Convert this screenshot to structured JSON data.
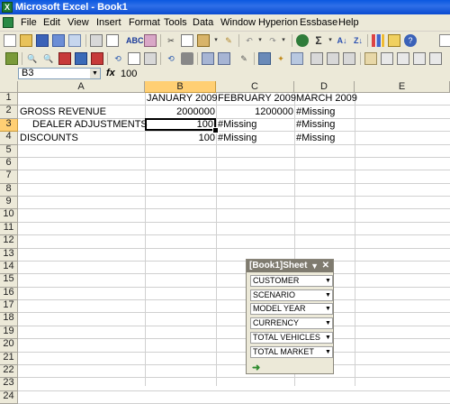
{
  "window": {
    "title": "Microsoft Excel - Book1"
  },
  "menu": [
    "File",
    "Edit",
    "View",
    "Insert",
    "Format",
    "Tools",
    "Data",
    "Window",
    "Hyperion",
    "Essbase",
    "Help"
  ],
  "formula_bar": {
    "name_box": "B3",
    "fx_symbol": "fx",
    "value": "100"
  },
  "columns": [
    "A",
    "B",
    "C",
    "D",
    "E"
  ],
  "rows": [
    "1",
    "2",
    "3",
    "4",
    "5",
    "6",
    "7",
    "8",
    "9",
    "10",
    "11",
    "12",
    "13",
    "14",
    "15",
    "16",
    "17",
    "18",
    "19",
    "20",
    "21",
    "22",
    "23",
    "24"
  ],
  "sheet": {
    "header": {
      "b1": "JANUARY 2009",
      "c1": "FEBRUARY 2009",
      "d1": "MARCH 2009"
    },
    "row2": {
      "a": "GROSS REVENUE",
      "b": "2000000",
      "c": "1200000",
      "d": "#Missing"
    },
    "row3": {
      "a": "DEALER ADJUSTMENTS",
      "b": "100",
      "c": "#Missing",
      "d": "#Missing"
    },
    "row4": {
      "a": "DISCOUNTS",
      "b": "100",
      "c": "#Missing",
      "d": "#Missing"
    }
  },
  "pov_panel": {
    "title": "[Book1]Sheet",
    "members": [
      "CUSTOMER",
      "SCENARIO",
      "MODEL YEAR",
      "CURRENCY",
      "TOTAL VEHICLES",
      "TOTAL MARKET"
    ]
  }
}
